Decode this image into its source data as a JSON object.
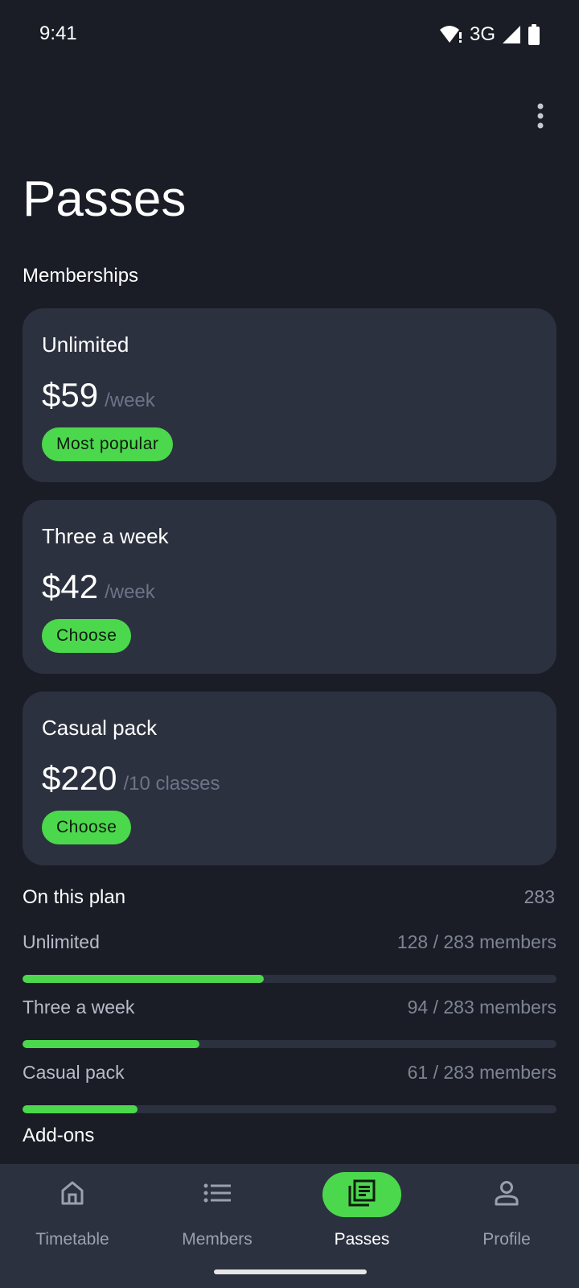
{
  "status_bar": {
    "time": "9:41",
    "network": "3G"
  },
  "header": {
    "title": "Passes"
  },
  "memberships": {
    "section_label": "Memberships",
    "cards": [
      {
        "name": "Unlimited",
        "price": "$59",
        "period": "/week",
        "action": "Most popular"
      },
      {
        "name": "Three a week",
        "price": "$42",
        "period": "/week",
        "action": "Choose"
      },
      {
        "name": "Casual pack",
        "price": "$220",
        "period": "/10 classes",
        "action": "Choose"
      }
    ]
  },
  "plan_stats": {
    "section_label": "On this plan",
    "total": "283",
    "rows": [
      {
        "label": "Unlimited",
        "count_text": "128 / 283 members",
        "fraction": 0.452
      },
      {
        "label": "Three a week",
        "count_text": "94 / 283 members",
        "fraction": 0.332
      },
      {
        "label": "Casual pack",
        "count_text": "61 / 283 members",
        "fraction": 0.216
      }
    ]
  },
  "addons": {
    "section_label": "Add-ons"
  },
  "bottom_nav": {
    "items": [
      {
        "label": "Timetable",
        "icon": "home-icon",
        "active": false
      },
      {
        "label": "Members",
        "icon": "list-icon",
        "active": false
      },
      {
        "label": "Passes",
        "icon": "passes-icon",
        "active": true
      },
      {
        "label": "Profile",
        "icon": "person-icon",
        "active": false
      }
    ]
  },
  "colors": {
    "background": "#1a1d26",
    "card": "#2c313f",
    "accent": "#4cd84c",
    "muted_text": "#6d7488"
  }
}
